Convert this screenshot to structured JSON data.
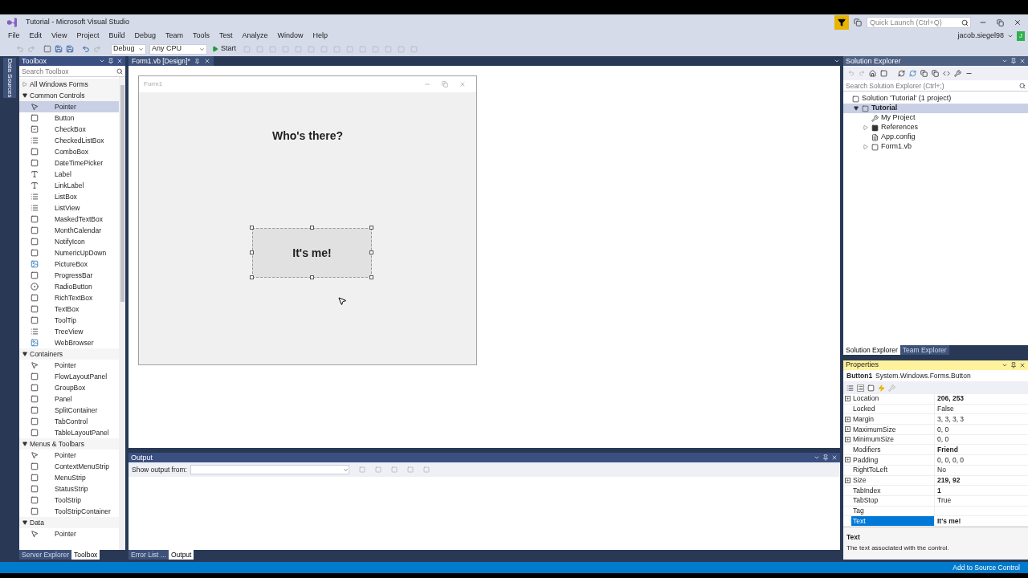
{
  "window": {
    "title": "Tutorial - Microsoft Visual Studio"
  },
  "quick_launch": {
    "placeholder": "Quick Launch (Ctrl+Q)"
  },
  "user": {
    "name": "jacob.siegel98",
    "initial": "J"
  },
  "menu": [
    "File",
    "Edit",
    "View",
    "Project",
    "Build",
    "Debug",
    "Team",
    "Tools",
    "Test",
    "Analyze",
    "Window",
    "Help"
  ],
  "toolbar": {
    "configuration": "Debug",
    "platform": "Any CPU",
    "start": "Start"
  },
  "side_tab": "Data Sources",
  "toolbox": {
    "title": "Toolbox",
    "search_placeholder": "Search Toolbox",
    "groups": [
      {
        "label": "All Windows Forms",
        "expanded": false
      },
      {
        "label": "Common Controls",
        "expanded": true,
        "items": [
          {
            "label": "Pointer",
            "kind": "pointer",
            "selected": true
          },
          {
            "label": "Button",
            "kind": "control",
            "selected": false
          },
          {
            "label": "CheckBox",
            "kind": "check",
            "selected": false
          },
          {
            "label": "CheckedListBox",
            "kind": "list",
            "selected": false
          },
          {
            "label": "ComboBox",
            "kind": "control",
            "selected": false
          },
          {
            "label": "DateTimePicker",
            "kind": "control",
            "selected": false
          },
          {
            "label": "Label",
            "kind": "text",
            "selected": false
          },
          {
            "label": "LinkLabel",
            "kind": "text",
            "selected": false
          },
          {
            "label": "ListBox",
            "kind": "list",
            "selected": false
          },
          {
            "label": "ListView",
            "kind": "list",
            "selected": false
          },
          {
            "label": "MaskedTextBox",
            "kind": "control",
            "selected": false
          },
          {
            "label": "MonthCalendar",
            "kind": "control",
            "selected": false
          },
          {
            "label": "NotifyIcon",
            "kind": "control",
            "selected": false
          },
          {
            "label": "NumericUpDown",
            "kind": "control",
            "selected": false
          },
          {
            "label": "PictureBox",
            "kind": "image",
            "selected": false
          },
          {
            "label": "ProgressBar",
            "kind": "control",
            "selected": false
          },
          {
            "label": "RadioButton",
            "kind": "radio",
            "selected": false
          },
          {
            "label": "RichTextBox",
            "kind": "control",
            "selected": false
          },
          {
            "label": "TextBox",
            "kind": "control",
            "selected": false
          },
          {
            "label": "ToolTip",
            "kind": "control",
            "selected": false
          },
          {
            "label": "TreeView",
            "kind": "list",
            "selected": false
          },
          {
            "label": "WebBrowser",
            "kind": "image",
            "selected": false
          }
        ]
      },
      {
        "label": "Containers",
        "expanded": true,
        "items": [
          {
            "label": "Pointer",
            "kind": "pointer",
            "selected": false
          },
          {
            "label": "FlowLayoutPanel",
            "kind": "control",
            "selected": false
          },
          {
            "label": "GroupBox",
            "kind": "control",
            "selected": false
          },
          {
            "label": "Panel",
            "kind": "control",
            "selected": false
          },
          {
            "label": "SplitContainer",
            "kind": "control",
            "selected": false
          },
          {
            "label": "TabControl",
            "kind": "control",
            "selected": false
          },
          {
            "label": "TableLayoutPanel",
            "kind": "control",
            "selected": false
          }
        ]
      },
      {
        "label": "Menus & Toolbars",
        "expanded": true,
        "items": [
          {
            "label": "Pointer",
            "kind": "pointer",
            "selected": false
          },
          {
            "label": "ContextMenuStrip",
            "kind": "control",
            "selected": false
          },
          {
            "label": "MenuStrip",
            "kind": "control",
            "selected": false
          },
          {
            "label": "StatusStrip",
            "kind": "control",
            "selected": false
          },
          {
            "label": "ToolStrip",
            "kind": "control",
            "selected": false
          },
          {
            "label": "ToolStripContainer",
            "kind": "control",
            "selected": false
          }
        ]
      },
      {
        "label": "Data",
        "expanded": true,
        "items": [
          {
            "label": "Pointer",
            "kind": "pointer",
            "selected": false
          }
        ]
      }
    ]
  },
  "left_tabs": [
    {
      "label": "Server Explorer",
      "selected": false
    },
    {
      "label": "Toolbox",
      "selected": true
    }
  ],
  "document_tab": {
    "label": "Form1.vb [Design]*"
  },
  "designer": {
    "form_title": "Form1",
    "label": "Who's there?",
    "button": "It's me!"
  },
  "output": {
    "title": "Output",
    "show_from": "Show output from:"
  },
  "output_tabs": [
    {
      "label": "Error List ...",
      "selected": false
    },
    {
      "label": "Output",
      "selected": true
    }
  ],
  "solution_explorer": {
    "title": "Solution Explorer",
    "search_placeholder": "Search Solution Explorer (Ctrl+;)",
    "tree": [
      {
        "label": "Solution 'Tutorial' (1 project)",
        "kind": "solution",
        "selected": false,
        "children": [
          {
            "label": "Tutorial",
            "kind": "project",
            "selected": true,
            "expanded": true,
            "children": [
              {
                "label": "My Project",
                "kind": "wrench",
                "selected": false
              },
              {
                "label": "References",
                "kind": "refs",
                "selected": false,
                "expanded": false
              },
              {
                "label": "App.config",
                "kind": "file",
                "selected": false
              },
              {
                "label": "Form1.vb",
                "kind": "form",
                "selected": false,
                "expanded": false
              }
            ]
          }
        ]
      }
    ]
  },
  "right_tabs": [
    {
      "label": "Solution Explorer",
      "selected": true
    },
    {
      "label": "Team Explorer",
      "selected": false
    }
  ],
  "properties": {
    "title": "Properties",
    "object": "Button1",
    "type": "System.Windows.Forms.Button",
    "rows": [
      {
        "name": "Location",
        "value": "206, 253",
        "expandable": true,
        "modified": true,
        "selected": false
      },
      {
        "name": "Locked",
        "value": "False",
        "expandable": false,
        "modified": false,
        "selected": false
      },
      {
        "name": "Margin",
        "value": "3, 3, 3, 3",
        "expandable": true,
        "modified": false,
        "selected": false
      },
      {
        "name": "MaximumSize",
        "value": "0, 0",
        "expandable": true,
        "modified": false,
        "selected": false
      },
      {
        "name": "MinimumSize",
        "value": "0, 0",
        "expandable": true,
        "modified": false,
        "selected": false
      },
      {
        "name": "Modifiers",
        "value": "Friend",
        "expandable": false,
        "modified": true,
        "selected": false
      },
      {
        "name": "Padding",
        "value": "0, 0, 0, 0",
        "expandable": true,
        "modified": false,
        "selected": false
      },
      {
        "name": "RightToLeft",
        "value": "No",
        "expandable": false,
        "modified": false,
        "selected": false
      },
      {
        "name": "Size",
        "value": "219, 92",
        "expandable": true,
        "modified": true,
        "selected": false
      },
      {
        "name": "TabIndex",
        "value": "1",
        "expandable": false,
        "modified": true,
        "selected": false
      },
      {
        "name": "TabStop",
        "value": "True",
        "expandable": false,
        "modified": false,
        "selected": false
      },
      {
        "name": "Tag",
        "expandable": false,
        "selected": false
      },
      {
        "name": "Text",
        "value": "It's me!",
        "expandable": false,
        "modified": true,
        "selected": true
      }
    ],
    "description_title": "Text",
    "description": "The text associated with the control."
  },
  "status_bar": {
    "text": "Add to Source Control"
  }
}
